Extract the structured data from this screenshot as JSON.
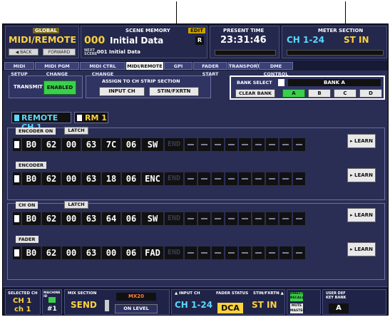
{
  "header": {
    "global_tag": "GLOBAL",
    "app_title": "MIDI/REMOTE",
    "back_label": "◀ BACK",
    "forward_label": "FORWARD ▶",
    "scene_memory_label": "SCENE MEMORY",
    "edit_tag": "EDIT",
    "scene_number": "000",
    "scene_title": "Initial Data",
    "r_badge": "R",
    "next_scene_label": "NEXT SCENE",
    "next_scene_value": "001 Initial Data",
    "present_time_label": "PRESENT TIME",
    "present_time": "23:31:46",
    "meter_section_label": "METER SECTION",
    "meter_ch": "CH 1-24",
    "meter_stin": "ST IN"
  },
  "tabs": [
    {
      "label": "MIDI SETUP"
    },
    {
      "label": "MIDI PGM CHANGE"
    },
    {
      "label": "MIDI CTRL CHANGE"
    },
    {
      "label": "MIDI/REMOTE"
    },
    {
      "label": "GPI"
    },
    {
      "label": "FADER START"
    },
    {
      "label": "TRANSPORT"
    },
    {
      "label": "DME CONTROL"
    }
  ],
  "panel": {
    "transmit_label": "TRANSMIT",
    "enabled_label": "ENABLED",
    "assign_label_1": "ASSIGN TO CH STRIP SECTION",
    "input_ch_label": "INPUT CH",
    "stin_label": "STIN/FXRTN",
    "bank_select_label": "BANK SELECT",
    "bank_value": "BANK A",
    "clear_bank_label": "CLEAR BANK",
    "banks": [
      "A",
      "B",
      "C",
      "D"
    ],
    "remote_ch_label": "REMOTE CH 1",
    "rm_label": "RM 1",
    "learn_label": "▸ LEARN"
  },
  "rows": [
    {
      "title": "ENCODER ON",
      "latch": "LATCH",
      "cells": [
        "B0",
        "62",
        "00",
        "63",
        "7C",
        "06",
        "SW",
        "END"
      ]
    },
    {
      "title": "ENCODER",
      "latch": "",
      "cells": [
        "B0",
        "62",
        "00",
        "63",
        "18",
        "06",
        "ENC",
        "END"
      ]
    },
    {
      "title": "CH ON",
      "latch": "LATCH",
      "cells": [
        "B0",
        "62",
        "00",
        "63",
        "64",
        "06",
        "SW",
        "END"
      ]
    },
    {
      "title": "FADER",
      "latch": "",
      "cells": [
        "B0",
        "62",
        "00",
        "63",
        "00",
        "06",
        "FAD",
        "END"
      ]
    }
  ],
  "footer": {
    "selected_ch_label": "SELECTED CH",
    "selected_ch_top": "CH 1",
    "selected_ch_bottom": "ch 1",
    "machine_id_label": "MACHINE ID",
    "machine_id_value": "#1",
    "mix_section_label": "MIX SECTION",
    "mix_send": "SEND",
    "mix_level_btn": "ON LEVEL",
    "mix_bus_label": "MX20",
    "input_ch_label": "▲ INPUT CH",
    "input_ch_value": "CH 1-24",
    "fader_status_label": "FADER STATUS",
    "fader_status_value": "DCA",
    "stin_label": "STIN/FXRTN ▲",
    "stin_value": "ST IN",
    "direct_recall_label": "DIRECT RECALL",
    "mute_master_label": "MUTE MASTER",
    "user_def_label": "USER DEF KEY BANK",
    "user_def_value": "A"
  }
}
